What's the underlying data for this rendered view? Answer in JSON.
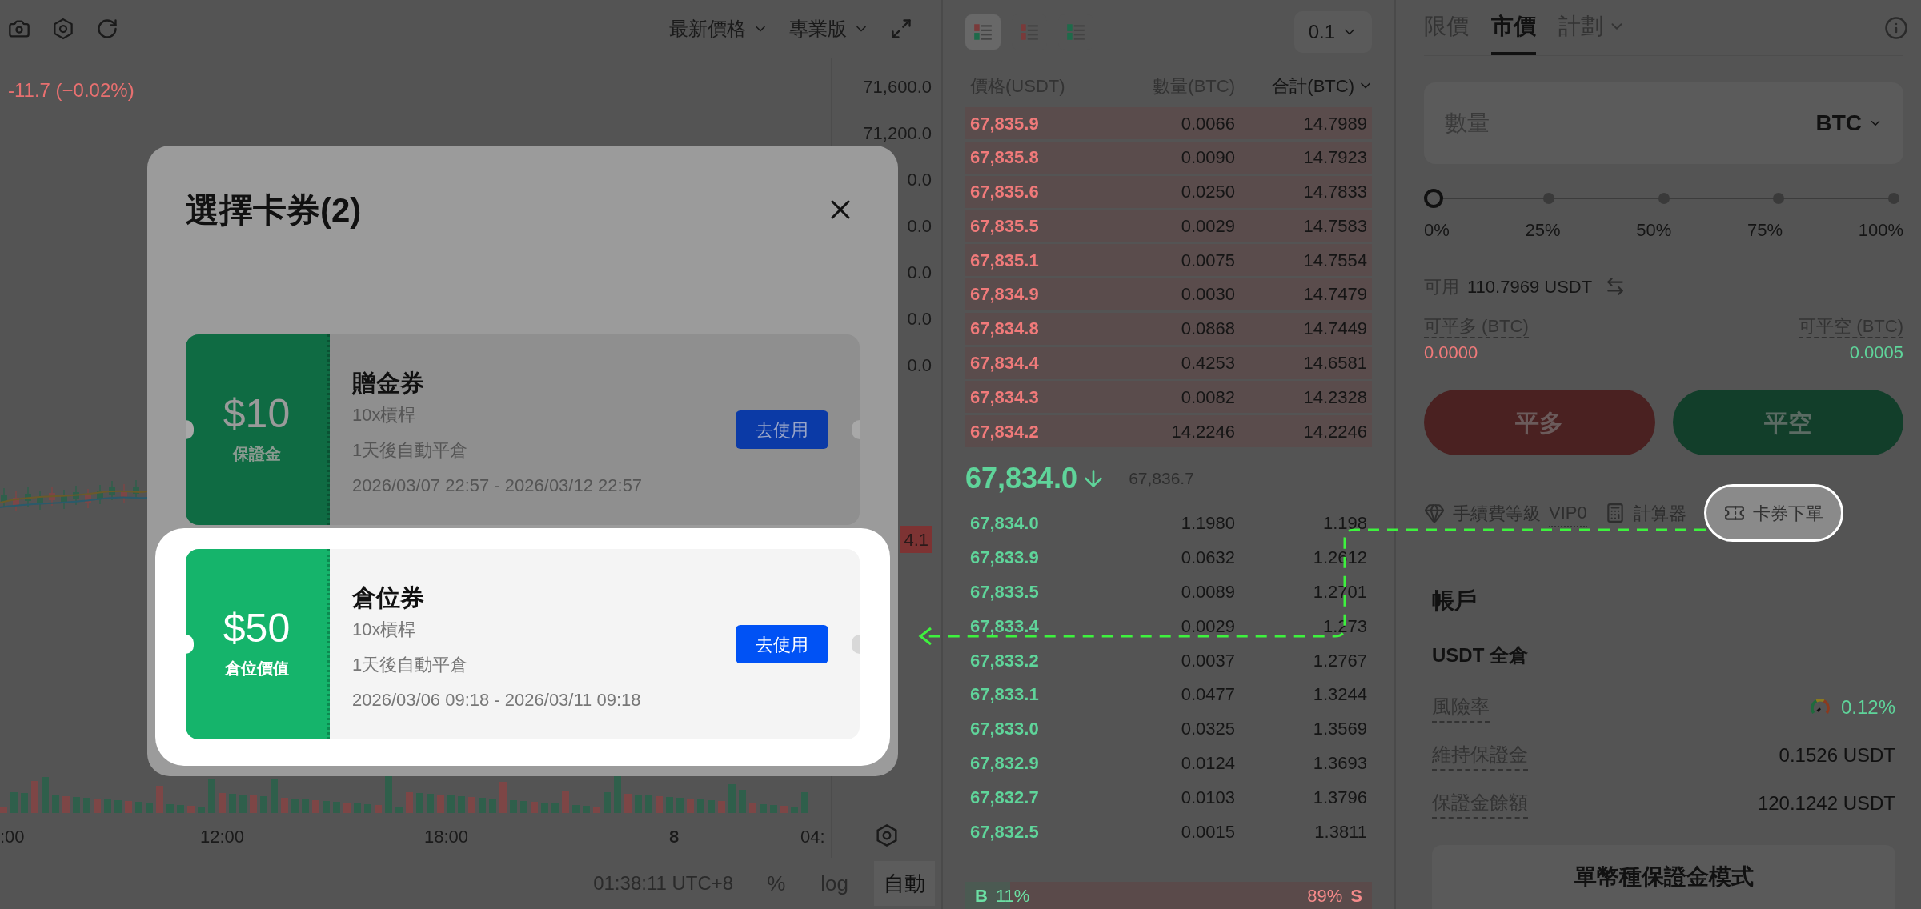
{
  "chart_toolbar": {
    "price_type": "最新價格",
    "version": "專業版"
  },
  "chart": {
    "change": "-11.7 (−0.02%)",
    "price_axis": [
      "71,600.0",
      "71,200.0",
      "0.0",
      "0.0",
      "0.0",
      "0.0",
      "0.0"
    ],
    "price_tag": "4.1",
    "time_axis": [
      {
        "label": ":00",
        "bold": false
      },
      {
        "label": "12:00",
        "bold": false
      },
      {
        "label": "18:00",
        "bold": false
      },
      {
        "label": "8",
        "bold": true
      },
      {
        "label": "04:",
        "bold": false
      }
    ],
    "clock": "01:38:11 UTC+8",
    "scale_options": [
      {
        "label": "%",
        "selected": false
      },
      {
        "label": "log",
        "selected": false
      },
      {
        "label": "自動",
        "selected": true
      }
    ]
  },
  "order_book": {
    "views": [
      {
        "kind": "both",
        "selected": true
      },
      {
        "kind": "asks",
        "selected": false
      },
      {
        "kind": "bids",
        "selected": false
      }
    ],
    "step": "0.1",
    "columns": [
      "價格(USDT)",
      "數量(BTC)",
      "合計(BTC)"
    ],
    "asks": [
      {
        "price": "67,835.9",
        "amount": "0.0066",
        "total": "14.7989"
      },
      {
        "price": "67,835.8",
        "amount": "0.0090",
        "total": "14.7923"
      },
      {
        "price": "67,835.6",
        "amount": "0.0250",
        "total": "14.7833"
      },
      {
        "price": "67,835.5",
        "amount": "0.0029",
        "total": "14.7583"
      },
      {
        "price": "67,835.1",
        "amount": "0.0075",
        "total": "14.7554"
      },
      {
        "price": "67,834.9",
        "amount": "0.0030",
        "total": "14.7479"
      },
      {
        "price": "67,834.8",
        "amount": "0.0868",
        "total": "14.7449"
      },
      {
        "price": "67,834.4",
        "amount": "0.4253",
        "total": "14.6581"
      },
      {
        "price": "67,834.3",
        "amount": "0.0082",
        "total": "14.2328"
      },
      {
        "price": "67,834.2",
        "amount": "14.2246",
        "total": "14.2246"
      }
    ],
    "last_price": "67,834.0",
    "mark_price": "67,836.7",
    "bids": [
      {
        "price": "67,834.0",
        "amount": "1.1980",
        "total": "1.198"
      },
      {
        "price": "67,833.9",
        "amount": "0.0632",
        "total": "1.2612"
      },
      {
        "price": "67,833.5",
        "amount": "0.0089",
        "total": "1.2701"
      },
      {
        "price": "67,833.4",
        "amount": "0.0029",
        "total": "1.273"
      },
      {
        "price": "67,833.2",
        "amount": "0.0037",
        "total": "1.2767"
      },
      {
        "price": "67,833.1",
        "amount": "0.0477",
        "total": "1.3244"
      },
      {
        "price": "67,833.0",
        "amount": "0.0325",
        "total": "1.3569"
      },
      {
        "price": "67,832.9",
        "amount": "0.0124",
        "total": "1.3693"
      },
      {
        "price": "67,832.7",
        "amount": "0.0103",
        "total": "1.3796"
      },
      {
        "price": "67,832.5",
        "amount": "0.0015",
        "total": "1.3811"
      }
    ],
    "buy_ratio": {
      "label": "B",
      "value": "11%",
      "level": 0.11
    },
    "sell_ratio": {
      "label": "S",
      "value": "89%"
    }
  },
  "order_form": {
    "tabs": [
      {
        "label": "限價",
        "selected": false,
        "has_menu": false
      },
      {
        "label": "市價",
        "selected": true,
        "has_menu": false
      },
      {
        "label": "計劃",
        "selected": false,
        "has_menu": true
      }
    ],
    "quantity": {
      "placeholder": "數量",
      "unit": "BTC"
    },
    "slider": {
      "level": 0,
      "marks": [
        "0%",
        "25%",
        "50%",
        "75%",
        "100%"
      ]
    },
    "available": {
      "label": "可用",
      "value": "110.7969 USDT"
    },
    "close_long": {
      "label": "可平多 (BTC)",
      "value": "0.0000"
    },
    "close_short": {
      "label": "可平空 (BTC)",
      "value": "0.0005"
    },
    "buttons": [
      "平多",
      "平空"
    ],
    "tools": [
      {
        "kind": "fee",
        "label": "手續費等級",
        "value": "VIP0",
        "highlighted": false
      },
      {
        "kind": "calculator",
        "label": "計算器",
        "highlighted": false
      },
      {
        "kind": "coupon",
        "label": "卡券下單",
        "highlighted": true
      }
    ]
  },
  "account": {
    "title": "帳戶",
    "mode": "USDT 全倉",
    "rows": [
      {
        "kind": "risk",
        "label": "風險率",
        "value": "0.12%"
      },
      {
        "kind": "plain",
        "label": "維持保證金",
        "value": "0.1526 USDT"
      },
      {
        "kind": "plain",
        "label": "保證金餘額",
        "value": "120.1242 USDT"
      }
    ],
    "button": "單幣種保證金模式"
  },
  "modal": {
    "title": "選擇卡券(2)",
    "coupons": [
      {
        "amount": "$10",
        "amount_label": "保證金",
        "name": "贈金券",
        "leverage": "10x槓桿",
        "auto_close": "1天後自動平倉",
        "validity": "2026/03/07 22:57 - 2026/03/12 22:57",
        "button": "去使用",
        "highlighted": false
      },
      {
        "amount": "$50",
        "amount_label": "倉位價值",
        "name": "倉位券",
        "leverage": "10x槓桿",
        "auto_close": "1天後自動平倉",
        "validity": "2026/03/06 09:18 - 2026/03/11 09:18",
        "button": "去使用",
        "highlighted": true
      }
    ]
  }
}
